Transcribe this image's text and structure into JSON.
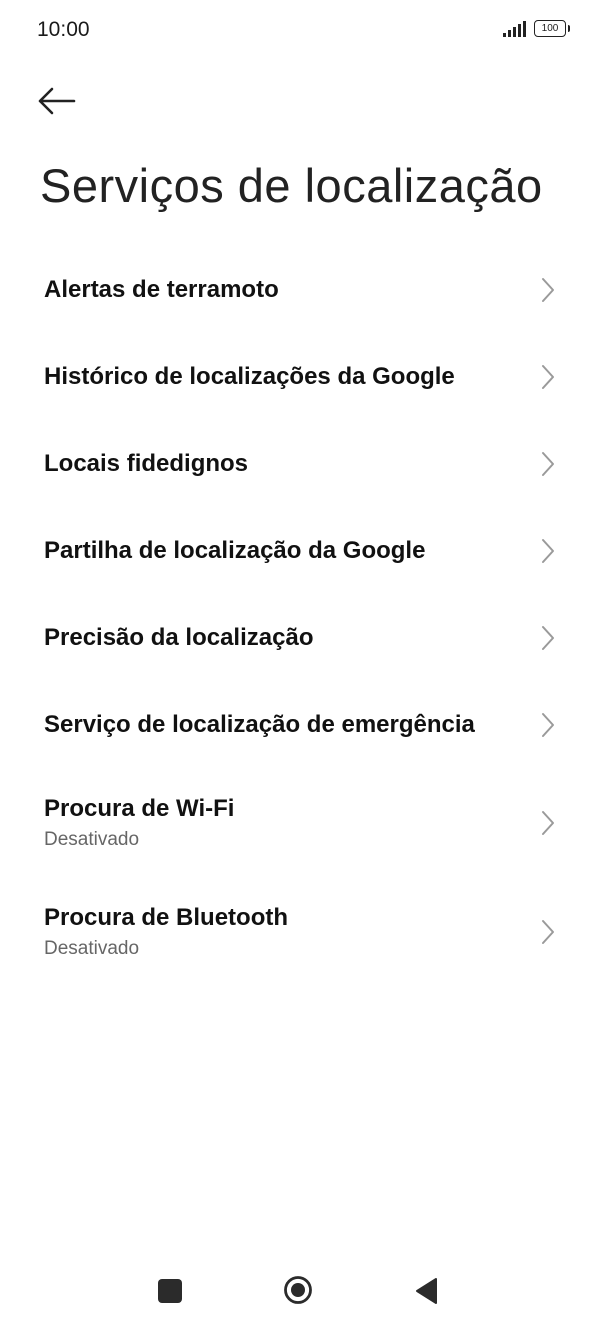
{
  "status_bar": {
    "time": "10:00",
    "battery": "100"
  },
  "page": {
    "title": "Serviços de localização"
  },
  "items": [
    {
      "label": "Alertas de terramoto"
    },
    {
      "label": "Histórico de localizações da Google"
    },
    {
      "label": "Locais fidedignos"
    },
    {
      "label": "Partilha de localização da Google"
    },
    {
      "label": "Precisão da localização"
    },
    {
      "label": "Serviço de localização de emergência"
    },
    {
      "label": "Procura de Wi-Fi",
      "subtitle": "Desativado"
    },
    {
      "label": "Procura de Bluetooth",
      "subtitle": "Desativado"
    }
  ],
  "icons": {
    "back": "arrow-left-icon",
    "chevron": "chevron-right-icon",
    "nav_recent": "square-icon",
    "nav_home": "circle-icon",
    "nav_back": "triangle-back-icon"
  },
  "colors": {
    "background": "#ffffff",
    "text": "#111111",
    "secondary_text": "#666666",
    "chevron": "#9a9a9a"
  }
}
